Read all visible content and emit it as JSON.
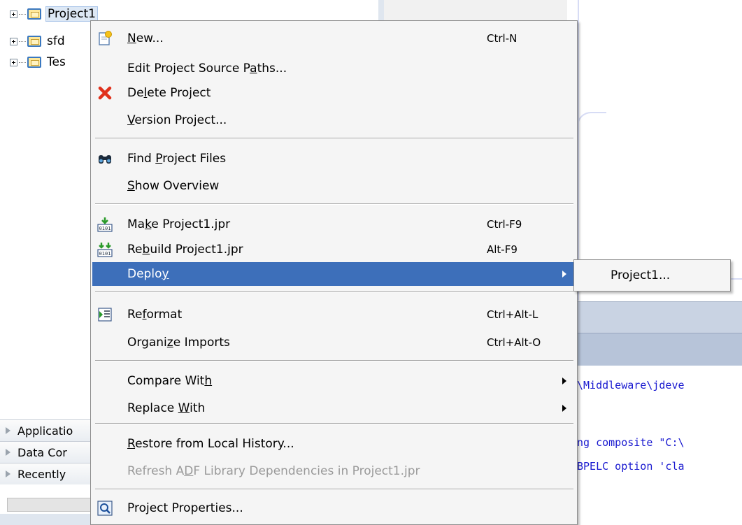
{
  "tree": {
    "items": [
      {
        "label": "Project1",
        "selected": true
      },
      {
        "label": "sfd",
        "selected": false
      },
      {
        "label": "Tes",
        "selected": false
      }
    ]
  },
  "accordion": {
    "items": [
      "Applicatio",
      "Data Cor",
      "Recently"
    ]
  },
  "log": {
    "lines": [
      "\\Middleware\\jdeve",
      "ng composite \"C:\\",
      "BPELC option 'cla"
    ]
  },
  "menu": {
    "new": {
      "pre": "",
      "u": "N",
      "post": "ew...",
      "shortcut": "Ctrl-N",
      "icon": "new-file-icon"
    },
    "edit_paths": {
      "pre": "Edit Project Source P",
      "u": "a",
      "post": "ths..."
    },
    "delete": {
      "pre": "De",
      "u": "l",
      "post": "ete Project",
      "icon": "delete-icon"
    },
    "version": {
      "pre": "",
      "u": "V",
      "post": "ersion Project..."
    },
    "find": {
      "pre": "Find ",
      "u": "P",
      "post": "roject Files",
      "icon": "binoculars-icon"
    },
    "overview": {
      "pre": "",
      "u": "S",
      "post": "how Overview"
    },
    "make": {
      "pre": "Ma",
      "u": "k",
      "post": "e Project1.jpr",
      "shortcut": "Ctrl-F9",
      "icon": "make-icon"
    },
    "rebuild": {
      "pre": "Re",
      "u": "b",
      "post": "uild Project1.jpr",
      "shortcut": "Alt-F9",
      "icon": "rebuild-icon"
    },
    "deploy": {
      "pre": "Deplo",
      "u": "y",
      "post": ""
    },
    "reformat": {
      "pre": "Re",
      "u": "f",
      "post": "ormat",
      "shortcut": "Ctrl+Alt-L",
      "icon": "reformat-icon"
    },
    "organize": {
      "pre": "Organi",
      "u": "z",
      "post": "e Imports",
      "shortcut": "Ctrl+Alt-O"
    },
    "compare": {
      "pre": "Compare Wit",
      "u": "h",
      "post": ""
    },
    "replace": {
      "pre": "Replace ",
      "u": "W",
      "post": "ith"
    },
    "restore": {
      "pre": "",
      "u": "R",
      "post": "estore from Local History..."
    },
    "refresh": {
      "pre": "Refresh A",
      "u": "D",
      "post": "F Library Dependencies in Project1.jpr"
    },
    "properties": {
      "pre": "Pro",
      "u": "j",
      "post": "ect Properties...",
      "icon": "properties-icon"
    }
  },
  "submenu": {
    "item": "Project1..."
  },
  "colors": {
    "highlight": "#3d6fba",
    "menu_bg": "#f5f5f5",
    "log_text": "#1a1ad0"
  }
}
